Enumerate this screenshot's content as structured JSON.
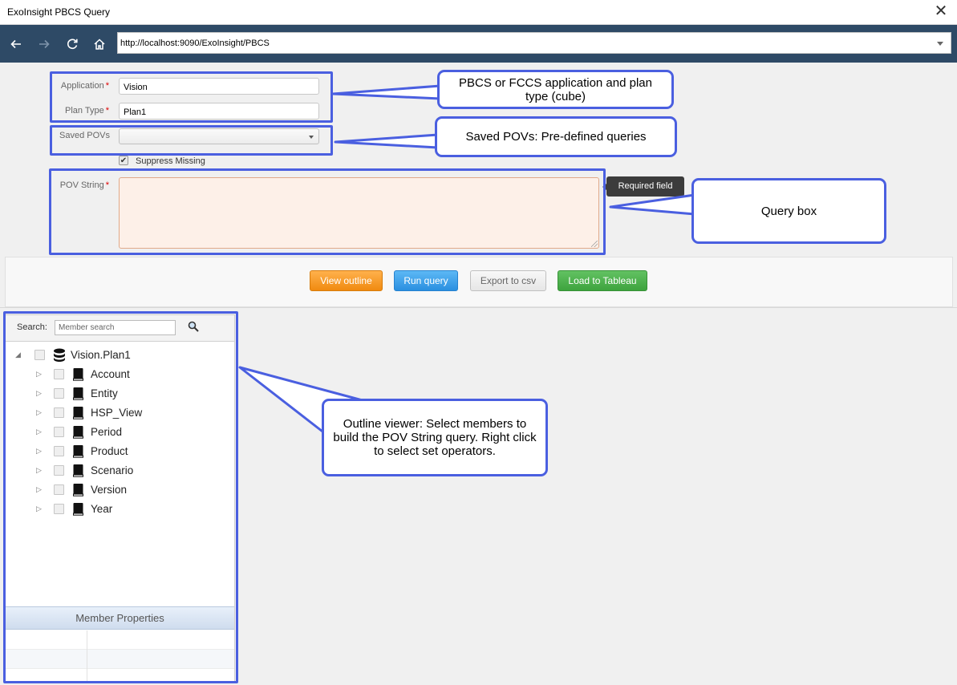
{
  "window": {
    "title": "ExoInsight PBCS Query"
  },
  "nav": {
    "url": "http://localhost:9090/ExoInsight/PBCS"
  },
  "form": {
    "application_label": "Application",
    "application_value": "Vision",
    "plan_type_label": "Plan Type",
    "plan_type_value": "Plan1",
    "saved_povs_label": "Saved POVs",
    "saved_povs_value": "",
    "suppress_missing_label": "Suppress Missing",
    "suppress_missing_checked": true,
    "pov_string_label": "POV String",
    "required_marker": "*",
    "tooltip": "Required field"
  },
  "buttons": {
    "view_outline": "View outline",
    "run_query": "Run query",
    "export_csv": "Export to csv",
    "load_tableau": "Load to Tableau"
  },
  "colors": {
    "highlight": "#4a5fe0",
    "navbar": "#2e4a66"
  },
  "outline": {
    "search_label": "Search:",
    "search_placeholder": "Member search",
    "root": "Vision.Plan1",
    "dimensions": [
      "Account",
      "Entity",
      "HSP_View",
      "Period",
      "Product",
      "Scenario",
      "Version",
      "Year"
    ],
    "member_properties_header": "Member Properties"
  },
  "callouts": {
    "app_plan": "PBCS or FCCS application and plan type (cube)",
    "saved_povs": "Saved POVs: Pre-defined queries",
    "query_box": "Query box",
    "outline_viewer": "Outline viewer: Select members to build the POV String query. Right click to select set operators."
  }
}
